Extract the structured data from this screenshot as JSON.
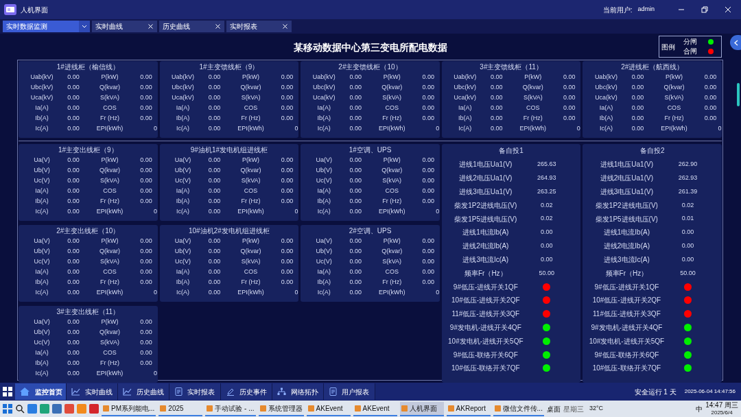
{
  "window": {
    "title": "人机界面",
    "user_label": "当前用户:",
    "user": "admin"
  },
  "tabs": [
    {
      "label": "实时数据监测",
      "selected": true,
      "kind": "dropdown"
    },
    {
      "label": "实时曲线",
      "selected": false,
      "kind": "closable"
    },
    {
      "label": "历史曲线",
      "selected": false,
      "kind": "closable"
    },
    {
      "label": "实时报表",
      "selected": false,
      "kind": "closable"
    }
  ],
  "page_title": "某移动数据中心第三变电所配电数据",
  "legend": {
    "title": "图例",
    "items": [
      {
        "label": "分闸",
        "color": "#00ee00"
      },
      {
        "label": "合闸",
        "color": "#ff0000"
      }
    ]
  },
  "top_panels": [
    {
      "title": "1#进线柜（榆信线）",
      "rows": [
        [
          "Uab(kV)",
          "0.00",
          "P(kW)",
          "0.00"
        ],
        [
          "Ubc(kV)",
          "0.00",
          "Q(kvar)",
          "0.00"
        ],
        [
          "Uca(kV)",
          "0.00",
          "S(kVA)",
          "0.00"
        ],
        [
          "Ia(A)",
          "0.00",
          "COS",
          "0.00"
        ],
        [
          "Ib(A)",
          "0.00",
          "Fr (Hz)",
          "0.00"
        ],
        [
          "Ic(A)",
          "0.00",
          "EPI(kWh)",
          "0"
        ]
      ]
    },
    {
      "title": "1#主变馈线柜（9）",
      "rows": [
        [
          "Uab(kV)",
          "0.00",
          "P(kW)",
          "0.00"
        ],
        [
          "Ubc(kV)",
          "0.00",
          "Q(kvar)",
          "0.00"
        ],
        [
          "Uca(kV)",
          "0.00",
          "S(kVA)",
          "0.00"
        ],
        [
          "Ia(A)",
          "0.00",
          "COS",
          "0.00"
        ],
        [
          "Ib(A)",
          "0.00",
          "Fr (Hz)",
          "0.00"
        ],
        [
          "Ic(A)",
          "0.00",
          "EPI(kWh)",
          "0"
        ]
      ]
    },
    {
      "title": "2#主变馈线柜（10）",
      "rows": [
        [
          "Uab(kV)",
          "0.00",
          "P(kW)",
          "0.00"
        ],
        [
          "Ubc(kV)",
          "0.00",
          "Q(kvar)",
          "0.00"
        ],
        [
          "Uca(kV)",
          "0.00",
          "S(kVA)",
          "0.00"
        ],
        [
          "Ia(A)",
          "0.00",
          "COS",
          "0.00"
        ],
        [
          "Ib(A)",
          "0.00",
          "Fr (Hz)",
          "0.00"
        ],
        [
          "Ic(A)",
          "0.00",
          "EPI(kWh)",
          "0"
        ]
      ]
    },
    {
      "title": "3#主变馈线柜（11）",
      "rows": [
        [
          "Uab(kV)",
          "0.00",
          "P(kW)",
          "0.00"
        ],
        [
          "Ubc(kV)",
          "0.00",
          "Q(kvar)",
          "0.00"
        ],
        [
          "Uca(kV)",
          "0.00",
          "S(kVA)",
          "0.00"
        ],
        [
          "Ia(A)",
          "0.00",
          "COS",
          "0.00"
        ],
        [
          "Ib(A)",
          "0.00",
          "Fr (Hz)",
          "0.00"
        ],
        [
          "Ic(A)",
          "0.00",
          "EPI(kWh)",
          "0"
        ]
      ]
    },
    {
      "title": "2#进线柜（航西线）",
      "rows": [
        [
          "Uab(kV)",
          "0.00",
          "P(kW)",
          "0.00"
        ],
        [
          "Ubc(kV)",
          "0.00",
          "Q(kvar)",
          "0.00"
        ],
        [
          "Uca(kV)",
          "0.00",
          "S(kVA)",
          "0.00"
        ],
        [
          "Ia(A)",
          "0.00",
          "COS",
          "0.00"
        ],
        [
          "Ib(A)",
          "0.00",
          "Fr (Hz)",
          "0.00"
        ],
        [
          "Ic(A)",
          "0.00",
          "EPI(kWh)",
          "0"
        ]
      ]
    }
  ],
  "lower_columns": [
    [
      {
        "title": "1#主变出线柜（9）",
        "rows": [
          [
            "Ua(V)",
            "0.00",
            "P(kW)",
            "0.00"
          ],
          [
            "Ub(V)",
            "0.00",
            "Q(kvar)",
            "0.00"
          ],
          [
            "Uc(V)",
            "0.00",
            "S(kVA)",
            "0.00"
          ],
          [
            "Ia(A)",
            "0.00",
            "COS",
            "0.00"
          ],
          [
            "Ib(A)",
            "0.00",
            "Fr (Hz)",
            "0.00"
          ],
          [
            "Ic(A)",
            "0.00",
            "EPI(kWh)",
            "0"
          ]
        ]
      },
      {
        "title": "2#主变出线柜（10）",
        "rows": [
          [
            "Ua(V)",
            "0.00",
            "P(kW)",
            "0.00"
          ],
          [
            "Ub(V)",
            "0.00",
            "Q(kvar)",
            "0.00"
          ],
          [
            "Uc(V)",
            "0.00",
            "S(kVA)",
            "0.00"
          ],
          [
            "Ia(A)",
            "0.00",
            "COS",
            "0.00"
          ],
          [
            "Ib(A)",
            "0.00",
            "Fr (Hz)",
            "0.00"
          ],
          [
            "Ic(A)",
            "0.00",
            "EPI(kWh)",
            "0"
          ]
        ]
      },
      {
        "title": "3#主变出线柜（11）",
        "rows": [
          [
            "Ua(V)",
            "0.00",
            "P(kW)",
            "0.00"
          ],
          [
            "Ub(V)",
            "0.00",
            "Q(kvar)",
            "0.00"
          ],
          [
            "Uc(V)",
            "0.00",
            "S(kVA)",
            "0.00"
          ],
          [
            "Ia(A)",
            "0.00",
            "COS",
            "0.00"
          ],
          [
            "Ib(A)",
            "0.00",
            "Fr (Hz)",
            "0.00"
          ],
          [
            "Ic(A)",
            "0.00",
            "EPI(kWh)",
            "0"
          ]
        ]
      }
    ],
    [
      {
        "title": "9#油机1#发电机组进线柜",
        "rows": [
          [
            "Ua(V)",
            "0.00",
            "P(kW)",
            "0.00"
          ],
          [
            "Ub(V)",
            "0.00",
            "Q(kvar)",
            "0.00"
          ],
          [
            "Uc(V)",
            "0.00",
            "S(kVA)",
            "0.00"
          ],
          [
            "Ia(A)",
            "0.00",
            "COS",
            "0.00"
          ],
          [
            "Ib(A)",
            "0.00",
            "Fr (Hz)",
            "0.00"
          ],
          [
            "Ic(A)",
            "0.00",
            "EPI(kWh)",
            "0"
          ]
        ]
      },
      {
        "title": "10#油机2#发电机组进线柜",
        "rows": [
          [
            "Ua(V)",
            "0.00",
            "P(kW)",
            "0.00"
          ],
          [
            "Ub(V)",
            "0.00",
            "Q(kvar)",
            "0.00"
          ],
          [
            "Uc(V)",
            "0.00",
            "S(kVA)",
            "0.00"
          ],
          [
            "Ia(A)",
            "0.00",
            "COS",
            "0.00"
          ],
          [
            "Ib(A)",
            "0.00",
            "Fr (Hz)",
            "0.00"
          ],
          [
            "Ic(A)",
            "0.00",
            "EPI(kWh)",
            "0"
          ]
        ]
      }
    ],
    [
      {
        "title": "1#空调、UPS",
        "rows": [
          [
            "Ua(V)",
            "0.00",
            "P(kW)",
            "0.00"
          ],
          [
            "Ub(V)",
            "0.00",
            "Q(kvar)",
            "0.00"
          ],
          [
            "Uc(V)",
            "0.00",
            "S(kVA)",
            "0.00"
          ],
          [
            "Ia(A)",
            "0.00",
            "COS",
            "0.00"
          ],
          [
            "Ib(A)",
            "0.00",
            "Fr (Hz)",
            "0.00"
          ],
          [
            "Ic(A)",
            "0.00",
            "EPI(kWh)",
            "0"
          ]
        ]
      },
      {
        "title": "2#空调、UPS",
        "rows": [
          [
            "Ua(V)",
            "0.00",
            "P(kW)",
            "0.00"
          ],
          [
            "Ub(V)",
            "0.00",
            "Q(kvar)",
            "0.00"
          ],
          [
            "Uc(V)",
            "0.00",
            "S(kVA)",
            "0.00"
          ],
          [
            "Ia(A)",
            "0.00",
            "COS",
            "0.00"
          ],
          [
            "Ib(A)",
            "0.00",
            "Fr (Hz)",
            "0.00"
          ],
          [
            "Ic(A)",
            "0.00",
            "EPI(kWh)",
            "0"
          ]
        ]
      }
    ]
  ],
  "backup_panels": [
    {
      "title": "备自投1",
      "rows": [
        {
          "kind": "reading",
          "label": "进线1电压Ua1(V)",
          "value": "265.63"
        },
        {
          "kind": "reading",
          "label": "进线2电压Ua1(V)",
          "value": "264.93"
        },
        {
          "kind": "reading",
          "label": "进线3电压Ua1(V)",
          "value": "263.25"
        },
        {
          "kind": "reading",
          "label": "柴发1P2进线电压(V)",
          "value": "0.02"
        },
        {
          "kind": "reading",
          "label": "柴发1P5进线电压(V)",
          "value": "0.02"
        },
        {
          "kind": "reading",
          "label": "进线1电流Ib(A)",
          "value": "0.00"
        },
        {
          "kind": "reading",
          "label": "进线2电流Ib(A)",
          "value": "0.00"
        },
        {
          "kind": "reading",
          "label": "进线3电流Ic(A)",
          "value": "0.00"
        },
        {
          "kind": "reading",
          "label": "频率Fr（Hz）",
          "value": "50.00"
        },
        {
          "kind": "switch",
          "label": "9#低压-进线开关1QF",
          "color": "#ff0000"
        },
        {
          "kind": "switch",
          "label": "10#低压-进线开关2QF",
          "color": "#ff0000"
        },
        {
          "kind": "switch",
          "label": "11#低压-进线开关3QF",
          "color": "#ff0000"
        },
        {
          "kind": "switch",
          "label": "9#发电机-进线开关4QF",
          "color": "#00ee00"
        },
        {
          "kind": "switch",
          "label": "10#发电机-进线开关5QF",
          "color": "#00ee00"
        },
        {
          "kind": "switch",
          "label": "9#低压-联络开关6QF",
          "color": "#00ee00"
        },
        {
          "kind": "switch",
          "label": "10#低压-联络开关7QF",
          "color": "#00ee00"
        }
      ]
    },
    {
      "title": "备自投2",
      "rows": [
        {
          "kind": "reading",
          "label": "进线1电压Ua1(V)",
          "value": "262.90"
        },
        {
          "kind": "reading",
          "label": "进线2电压Ua1(V)",
          "value": "262.93"
        },
        {
          "kind": "reading",
          "label": "进线3电压Ua1(V)",
          "value": "261.39"
        },
        {
          "kind": "reading",
          "label": "柴发1P2进线电压(V)",
          "value": "0.02"
        },
        {
          "kind": "reading",
          "label": "柴发1P5进线电压(V)",
          "value": "0.01"
        },
        {
          "kind": "reading",
          "label": "进线1电流Ib(A)",
          "value": "0.00"
        },
        {
          "kind": "reading",
          "label": "进线2电流Ib(A)",
          "value": "0.00"
        },
        {
          "kind": "reading",
          "label": "进线3电流Ic(A)",
          "value": "0.00"
        },
        {
          "kind": "reading",
          "label": "频率Fr（Hz）",
          "value": "50.00"
        },
        {
          "kind": "switch",
          "label": "9#低压-进线开关1QF",
          "color": "#ff0000"
        },
        {
          "kind": "switch",
          "label": "10#低压-进线开关2QF",
          "color": "#ff0000"
        },
        {
          "kind": "switch",
          "label": "11#低压-进线开关3QF",
          "color": "#ff0000"
        },
        {
          "kind": "switch",
          "label": "9#发电机-进线开关4QF",
          "color": "#00ee00"
        },
        {
          "kind": "switch",
          "label": "10#发电机-进线开关5QF",
          "color": "#00ee00"
        },
        {
          "kind": "switch",
          "label": "9#低压-联络开关6QF",
          "color": "#00ee00"
        },
        {
          "kind": "switch",
          "label": "10#低压-联络开关7QF",
          "color": "#00ee00"
        }
      ]
    }
  ],
  "bottom_nav": {
    "items": [
      {
        "label": "监控首页",
        "selected": true,
        "kind": "home"
      },
      {
        "label": "实时曲线",
        "selected": false,
        "kind": "chart"
      },
      {
        "label": "历史曲线",
        "selected": false,
        "kind": "chart"
      },
      {
        "label": "实时报表",
        "selected": false,
        "kind": "report"
      },
      {
        "label": "历史事件",
        "selected": false,
        "kind": "edit"
      },
      {
        "label": "网络拓扑",
        "selected": false,
        "kind": "network"
      },
      {
        "label": "用户报表",
        "selected": false,
        "kind": "report"
      }
    ],
    "status": "安全运行 1 天",
    "datetime": "2025-06-04 14:47:56"
  },
  "taskbar": {
    "tasks": [
      {
        "label": "PM系列能电...",
        "selected": false
      },
      {
        "label": "2025",
        "selected": false
      },
      {
        "label": "手动试验 - ...",
        "selected": false
      },
      {
        "label": "系统管理器",
        "selected": false
      },
      {
        "label": "AKEvent",
        "selected": false
      },
      {
        "label": "AKEvent",
        "selected": false
      },
      {
        "label": "人机界面",
        "selected": true
      },
      {
        "label": "AKReport",
        "selected": false
      },
      {
        "label": "微信文件传...",
        "selected": false
      }
    ],
    "desktop": "桌面",
    "weekday_widget": "星期三",
    "weather": "32°C",
    "ime": "中",
    "time": "14:47 周三",
    "date": "2025/6/4"
  }
}
